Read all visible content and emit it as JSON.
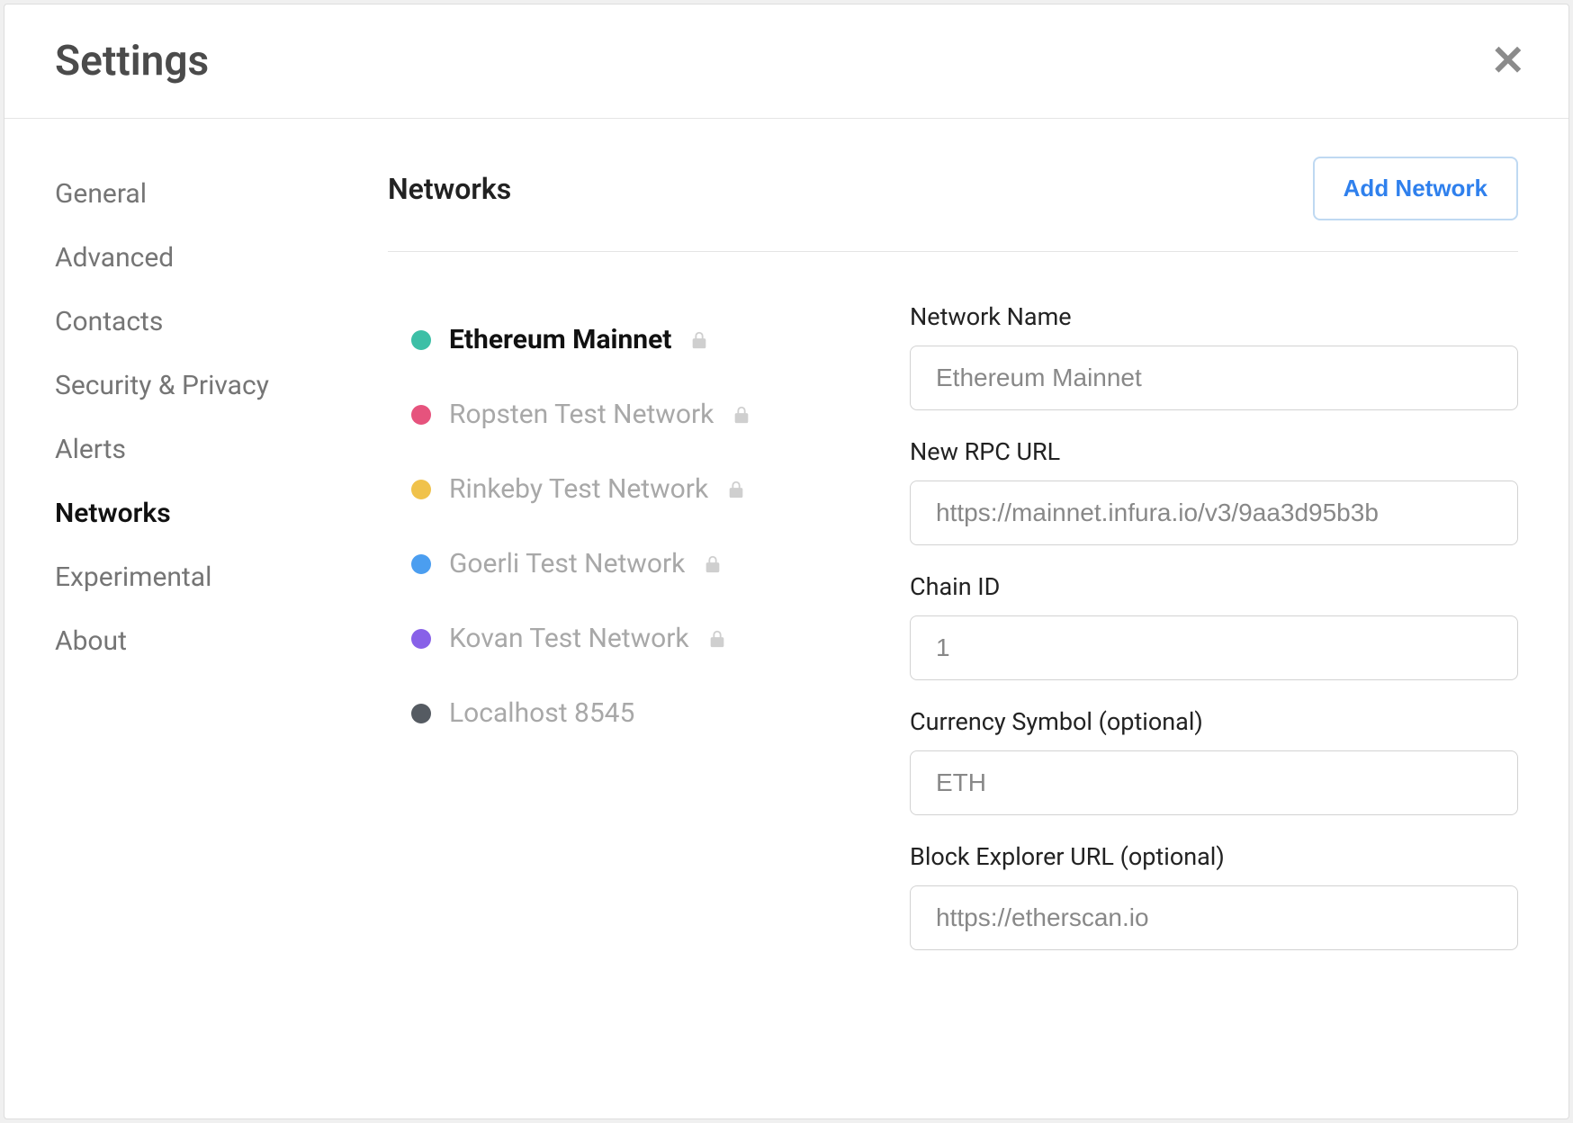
{
  "header": {
    "title": "Settings"
  },
  "sidebar": {
    "items": [
      {
        "label": "General",
        "active": false
      },
      {
        "label": "Advanced",
        "active": false
      },
      {
        "label": "Contacts",
        "active": false
      },
      {
        "label": "Security & Privacy",
        "active": false
      },
      {
        "label": "Alerts",
        "active": false
      },
      {
        "label": "Networks",
        "active": true
      },
      {
        "label": "Experimental",
        "active": false
      },
      {
        "label": "About",
        "active": false
      }
    ]
  },
  "main": {
    "title": "Networks",
    "add_button": "Add Network",
    "networks": [
      {
        "name": "Ethereum Mainnet",
        "color": "#3cbfa6",
        "selected": true,
        "locked": true
      },
      {
        "name": "Ropsten Test Network",
        "color": "#e6537d",
        "selected": false,
        "locked": true
      },
      {
        "name": "Rinkeby Test Network",
        "color": "#f0c24b",
        "selected": false,
        "locked": true
      },
      {
        "name": "Goerli Test Network",
        "color": "#4b9ef0",
        "selected": false,
        "locked": true
      },
      {
        "name": "Kovan Test Network",
        "color": "#8861e8",
        "selected": false,
        "locked": true
      },
      {
        "name": "Localhost 8545",
        "color": "#555b62",
        "selected": false,
        "locked": false
      }
    ],
    "form": {
      "network_name": {
        "label": "Network Name",
        "value": "Ethereum Mainnet"
      },
      "rpc_url": {
        "label": "New RPC URL",
        "value": "https://mainnet.infura.io/v3/9aa3d95b3b"
      },
      "chain_id": {
        "label": "Chain ID",
        "value": "1"
      },
      "currency_symbol": {
        "label": "Currency Symbol (optional)",
        "value": "ETH"
      },
      "block_explorer": {
        "label": "Block Explorer URL (optional)",
        "value": "https://etherscan.io"
      }
    }
  }
}
